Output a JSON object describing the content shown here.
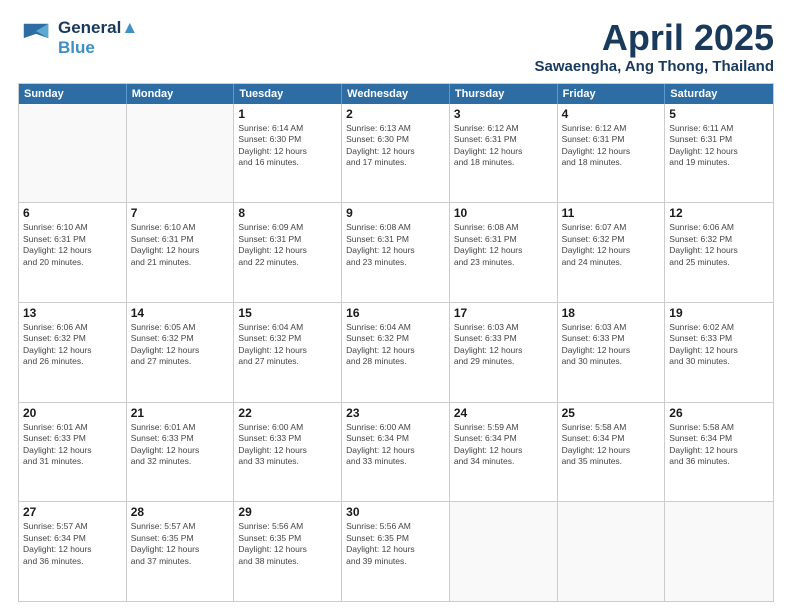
{
  "header": {
    "logo_line1": "General",
    "logo_line2": "Blue",
    "month_title": "April 2025",
    "subtitle": "Sawaengha, Ang Thong, Thailand"
  },
  "days_of_week": [
    "Sunday",
    "Monday",
    "Tuesday",
    "Wednesday",
    "Thursday",
    "Friday",
    "Saturday"
  ],
  "weeks": [
    [
      {
        "day": "",
        "empty": true
      },
      {
        "day": "",
        "empty": true
      },
      {
        "day": "1",
        "sunrise": "6:14 AM",
        "sunset": "6:30 PM",
        "daylight": "12 hours and 16 minutes."
      },
      {
        "day": "2",
        "sunrise": "6:13 AM",
        "sunset": "6:30 PM",
        "daylight": "12 hours and 17 minutes."
      },
      {
        "day": "3",
        "sunrise": "6:12 AM",
        "sunset": "6:31 PM",
        "daylight": "12 hours and 18 minutes."
      },
      {
        "day": "4",
        "sunrise": "6:12 AM",
        "sunset": "6:31 PM",
        "daylight": "12 hours and 18 minutes."
      },
      {
        "day": "5",
        "sunrise": "6:11 AM",
        "sunset": "6:31 PM",
        "daylight": "12 hours and 19 minutes."
      }
    ],
    [
      {
        "day": "6",
        "sunrise": "6:10 AM",
        "sunset": "6:31 PM",
        "daylight": "12 hours and 20 minutes."
      },
      {
        "day": "7",
        "sunrise": "6:10 AM",
        "sunset": "6:31 PM",
        "daylight": "12 hours and 21 minutes."
      },
      {
        "day": "8",
        "sunrise": "6:09 AM",
        "sunset": "6:31 PM",
        "daylight": "12 hours and 22 minutes."
      },
      {
        "day": "9",
        "sunrise": "6:08 AM",
        "sunset": "6:31 PM",
        "daylight": "12 hours and 23 minutes."
      },
      {
        "day": "10",
        "sunrise": "6:08 AM",
        "sunset": "6:31 PM",
        "daylight": "12 hours and 23 minutes."
      },
      {
        "day": "11",
        "sunrise": "6:07 AM",
        "sunset": "6:32 PM",
        "daylight": "12 hours and 24 minutes."
      },
      {
        "day": "12",
        "sunrise": "6:06 AM",
        "sunset": "6:32 PM",
        "daylight": "12 hours and 25 minutes."
      }
    ],
    [
      {
        "day": "13",
        "sunrise": "6:06 AM",
        "sunset": "6:32 PM",
        "daylight": "12 hours and 26 minutes."
      },
      {
        "day": "14",
        "sunrise": "6:05 AM",
        "sunset": "6:32 PM",
        "daylight": "12 hours and 27 minutes."
      },
      {
        "day": "15",
        "sunrise": "6:04 AM",
        "sunset": "6:32 PM",
        "daylight": "12 hours and 27 minutes."
      },
      {
        "day": "16",
        "sunrise": "6:04 AM",
        "sunset": "6:32 PM",
        "daylight": "12 hours and 28 minutes."
      },
      {
        "day": "17",
        "sunrise": "6:03 AM",
        "sunset": "6:33 PM",
        "daylight": "12 hours and 29 minutes."
      },
      {
        "day": "18",
        "sunrise": "6:03 AM",
        "sunset": "6:33 PM",
        "daylight": "12 hours and 30 minutes."
      },
      {
        "day": "19",
        "sunrise": "6:02 AM",
        "sunset": "6:33 PM",
        "daylight": "12 hours and 30 minutes."
      }
    ],
    [
      {
        "day": "20",
        "sunrise": "6:01 AM",
        "sunset": "6:33 PM",
        "daylight": "12 hours and 31 minutes."
      },
      {
        "day": "21",
        "sunrise": "6:01 AM",
        "sunset": "6:33 PM",
        "daylight": "12 hours and 32 minutes."
      },
      {
        "day": "22",
        "sunrise": "6:00 AM",
        "sunset": "6:33 PM",
        "daylight": "12 hours and 33 minutes."
      },
      {
        "day": "23",
        "sunrise": "6:00 AM",
        "sunset": "6:34 PM",
        "daylight": "12 hours and 33 minutes."
      },
      {
        "day": "24",
        "sunrise": "5:59 AM",
        "sunset": "6:34 PM",
        "daylight": "12 hours and 34 minutes."
      },
      {
        "day": "25",
        "sunrise": "5:58 AM",
        "sunset": "6:34 PM",
        "daylight": "12 hours and 35 minutes."
      },
      {
        "day": "26",
        "sunrise": "5:58 AM",
        "sunset": "6:34 PM",
        "daylight": "12 hours and 36 minutes."
      }
    ],
    [
      {
        "day": "27",
        "sunrise": "5:57 AM",
        "sunset": "6:34 PM",
        "daylight": "12 hours and 36 minutes."
      },
      {
        "day": "28",
        "sunrise": "5:57 AM",
        "sunset": "6:35 PM",
        "daylight": "12 hours and 37 minutes."
      },
      {
        "day": "29",
        "sunrise": "5:56 AM",
        "sunset": "6:35 PM",
        "daylight": "12 hours and 38 minutes."
      },
      {
        "day": "30",
        "sunrise": "5:56 AM",
        "sunset": "6:35 PM",
        "daylight": "12 hours and 39 minutes."
      },
      {
        "day": "",
        "empty": true
      },
      {
        "day": "",
        "empty": true
      },
      {
        "day": "",
        "empty": true
      }
    ]
  ]
}
